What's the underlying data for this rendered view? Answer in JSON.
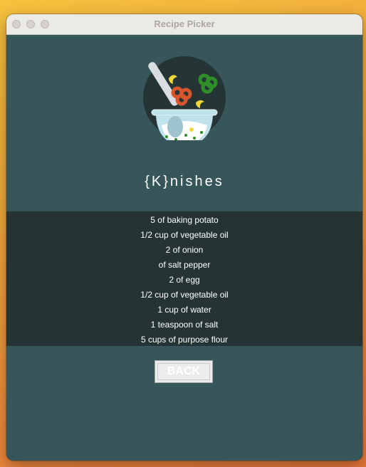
{
  "window": {
    "title": "Recipe Picker"
  },
  "recipe": {
    "title": "{K}nishes",
    "ingredients": [
      "5  of baking potato",
      "1/2 cup of vegetable oil",
      "2  of onion",
      "of salt pepper",
      "2  of egg",
      "1/2 cup of vegetable oil",
      "1 cup of water",
      "1 teaspoon of salt",
      "5 cups of purpose flour"
    ]
  },
  "buttons": {
    "back_label": "BACK"
  },
  "icons": {
    "logo": "salad-bowl-icon"
  },
  "colors": {
    "panel": "#365659",
    "list_band": "#263334",
    "button": "#ececec"
  }
}
